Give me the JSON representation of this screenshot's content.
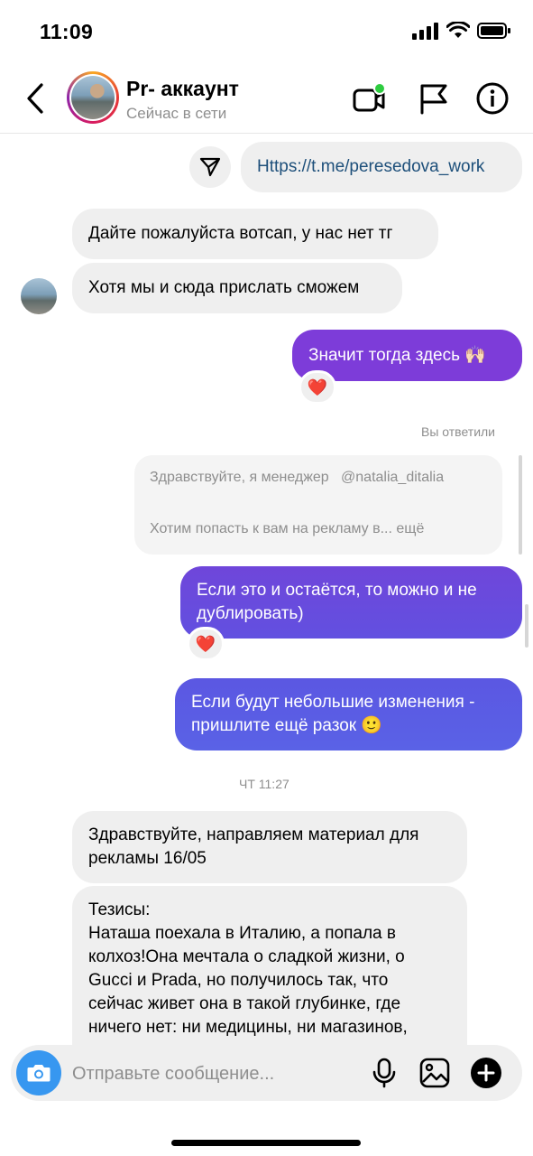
{
  "status_bar": {
    "time": "11:09"
  },
  "header": {
    "title": "Pr- аккаунт",
    "status": "Сейчас в сети"
  },
  "messages": {
    "link": "Https://t.me/peresedova_work",
    "in_1": "Дайте пожалуйста вотсап, у нас нет тг",
    "in_2": "Хотя мы и сюда прислать сможем",
    "out_1": "Значит тогда здесь 🙌🏻",
    "reaction_1": "❤️",
    "replied_label": "Вы ответили",
    "quote_line1": "Здравствуйте, я менеджер   @natalia_ditalia",
    "quote_line2": "Хотим попасть к вам на рекламу в... ещё",
    "out_2_l1": "Если это и остаётся, то можно и не",
    "out_2_l2": "дублировать)",
    "reaction_2": "❤️",
    "out_3_l1": "Если будут небольшие изменения -",
    "out_3_l2": "пришлите ещё разок 🙂",
    "timestamp": "ЧТ 11:27",
    "in_3_l1": "Здравствуйте, направляем материал для",
    "in_3_l2": "рекламы 16/05",
    "in_4_lines": [
      "Тезисы:",
      "Наташа поехала в Италию, а попала в",
      "колхоз!Она мечтала о сладкой жизни, о",
      "Gucci и Prada, но получилось так, что",
      "сейчас живет она в такой глубинке, где",
      "ничего нет: ни медицины, ни магазинов,"
    ]
  },
  "composer": {
    "placeholder": "Отправьте сообщение..."
  },
  "colors": {
    "out_gradient_top": "#7d3cd9",
    "out_gradient_bottom": "#5b5fe3",
    "link_text": "#1d4f7a",
    "accent_blue": "#3797f0",
    "online_dot": "#2ecc40"
  },
  "icons": [
    "back-chevron-icon",
    "video-call-icon",
    "flag-icon",
    "info-icon",
    "share-icon",
    "camera-icon",
    "microphone-icon",
    "gallery-icon",
    "plus-icon"
  ]
}
